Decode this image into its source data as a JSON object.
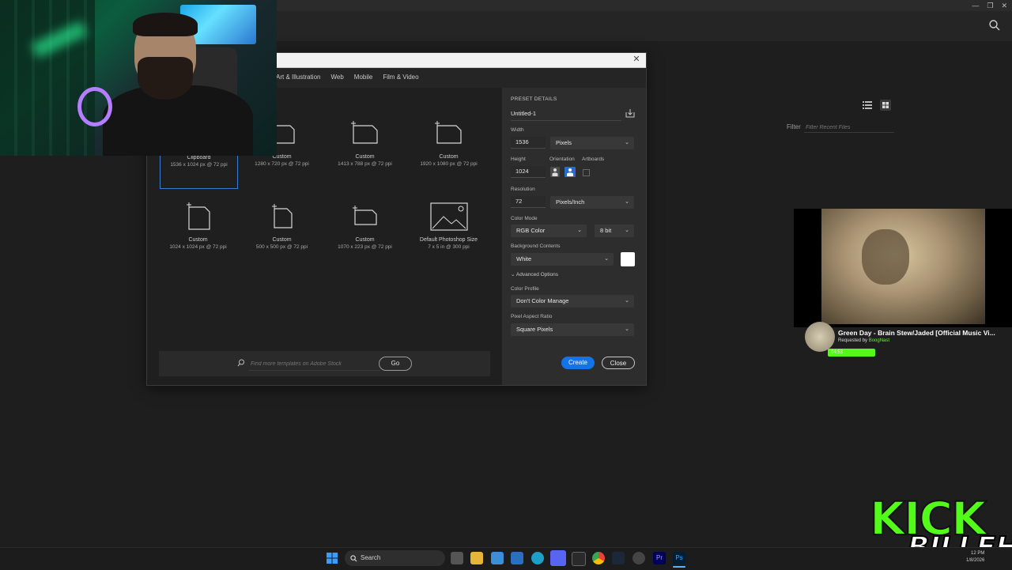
{
  "dialog": {
    "tabs": [
      "Art & Illustration",
      "Web",
      "Mobile",
      "Film & Video"
    ]
  },
  "presets": [
    {
      "name": "Clipboard",
      "desc": "1536 x 1024 px @ 72 ppi"
    },
    {
      "name": "Custom",
      "desc": "1280 x 720 px @ 72 ppi"
    },
    {
      "name": "Custom",
      "desc": "1413 x 788 px @ 72 ppi"
    },
    {
      "name": "Custom",
      "desc": "1920 x 1080 px @ 72 ppi"
    },
    {
      "name": "Custom",
      "desc": "1024 x 1024 px @ 72 ppi"
    },
    {
      "name": "Custom",
      "desc": "500 x 500 px @ 72 ppi"
    },
    {
      "name": "Custom",
      "desc": "1070 x 223 px @ 72 ppi"
    },
    {
      "name": "Default Photoshop Size",
      "desc": "7 x 5 in @ 300 ppi"
    }
  ],
  "stock": {
    "placeholder": "Find more templates on Adobe Stock",
    "go_label": "Go"
  },
  "details": {
    "header": "PRESET DETAILS",
    "doc_name": "Untitled-1",
    "width_label": "Width",
    "width_value": "1536",
    "width_unit": "Pixels",
    "height_label": "Height",
    "height_value": "1024",
    "orientation_label": "Orientation",
    "artboards_label": "Artboards",
    "resolution_label": "Resolution",
    "resolution_value": "72",
    "resolution_unit": "Pixels/Inch",
    "color_mode_label": "Color Mode",
    "color_mode": "RGB Color",
    "bit_depth": "8 bit",
    "bg_label": "Background Contents",
    "bg_value": "White",
    "advanced_label": "Advanced Options",
    "profile_label": "Color Profile",
    "profile_value": "Don't Color Manage",
    "aspect_label": "Pixel Aspect Ratio",
    "aspect_value": "Square Pixels",
    "create_label": "Create",
    "close_label": "Close"
  },
  "home": {
    "filter_label": "Filter",
    "filter_placeholder": "Filter Recent Files"
  },
  "music": {
    "title": "Green Day - Brain Stew/Jaded [Official Music Vi...",
    "requested_prefix": "Requested by",
    "requested_by": "BoogNast",
    "time": "04:53"
  },
  "overlay": {
    "kick": "KICK",
    "billeh": "BILLEH"
  },
  "taskbar": {
    "search_label": "Search",
    "time": "12 PM",
    "date": "1/8/2026"
  },
  "colors": {
    "accent": "#1473e6",
    "kick_green": "#53fc18",
    "select_border": "#3a7bd5"
  }
}
